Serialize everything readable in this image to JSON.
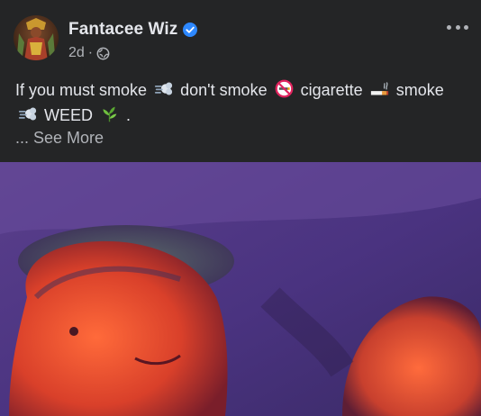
{
  "post": {
    "author": "Fantacee Wiz",
    "time": "2d",
    "separator": "·",
    "text_parts": {
      "p1": "If you must smoke",
      "p2": "don't smoke",
      "p3": "cigarette",
      "p4": "smoke",
      "p5": "WEED",
      "p6": "."
    },
    "see_more": "... See More"
  },
  "icons": {
    "verified": "verified-badge-icon",
    "audience": "globe-icon",
    "more": "more-options-icon",
    "emoji_1": "dash-smoke-emoji",
    "emoji_2": "no-smoking-emoji",
    "emoji_3": "cigarette-emoji",
    "emoji_4": "dash-smoke-emoji",
    "emoji_5": "herb-emoji"
  },
  "colors": {
    "background": "#242526",
    "primary_text": "#e4e6eb",
    "secondary_text": "#b0b3b8",
    "verified_blue": "#2d88ff"
  }
}
